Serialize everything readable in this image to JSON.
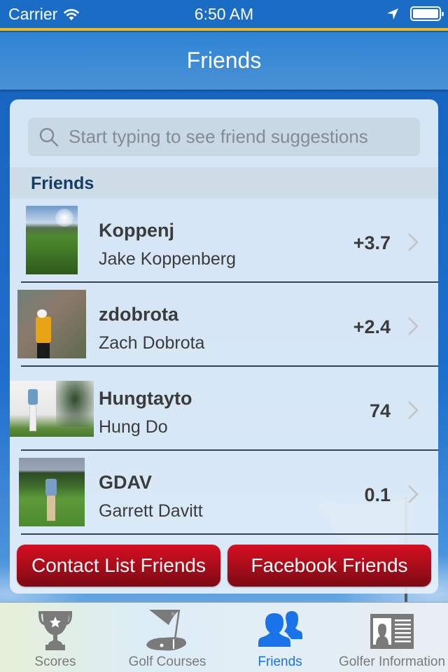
{
  "status_bar": {
    "carrier": "Carrier",
    "time": "6:50 AM",
    "battery_percent": 100
  },
  "nav": {
    "title": "Friends"
  },
  "search": {
    "placeholder": "Start typing to see friend suggestions",
    "value": ""
  },
  "section": {
    "title": "Friends"
  },
  "friends": [
    {
      "username": "Koppenj",
      "full_name": "Jake Koppenberg",
      "handicap": "+3.7",
      "avatar": "golf-course-sunrise-photo"
    },
    {
      "username": "zdobrota",
      "full_name": "Zach Dobrota",
      "handicap": "+2.4",
      "avatar": "golfer-yellow-shirt-photo"
    },
    {
      "username": "Hungtayto",
      "full_name": "Hung Do",
      "handicap": "74",
      "avatar": "golfer-swing-trees-photo"
    },
    {
      "username": "GDAV",
      "full_name": "Garrett Davitt",
      "handicap": "0.1",
      "avatar": "golfer-fairway-photo"
    }
  ],
  "buttons": {
    "contact_list": "Contact List Friends",
    "facebook": "Facebook Friends"
  },
  "tabs": [
    {
      "label": "Scores",
      "icon": "trophy-icon",
      "active": false
    },
    {
      "label": "Golf Courses",
      "icon": "golf-flag-icon",
      "active": false
    },
    {
      "label": "Friends",
      "icon": "friends-icon",
      "active": true
    },
    {
      "label": "Golfer Information",
      "icon": "id-card-icon",
      "active": false
    }
  ],
  "colors": {
    "status_bar": "#1a6cc4",
    "accent_gold": "#f0b81c",
    "button_red": "#c80d1e",
    "tab_active": "#1a73e8",
    "tab_inactive": "#7a7a7a",
    "section_title": "#133c69"
  }
}
